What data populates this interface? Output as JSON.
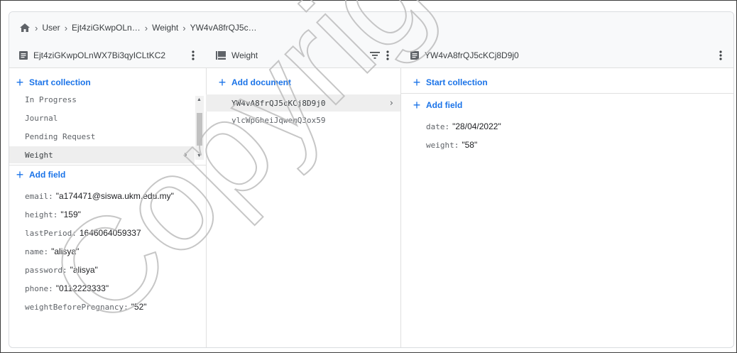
{
  "breadcrumb": {
    "items": [
      "User",
      "Ejt4ziGKwpOLn…",
      "Weight",
      "YW4vA8frQJ5c…"
    ]
  },
  "col1": {
    "title": "Ejt4ziGKwpOLnWX7Bi3qyICLtKC2",
    "start_collection": "Start collection",
    "collections": [
      "In Progress",
      "Journal",
      "Pending Request",
      "Weight"
    ],
    "add_field": "Add field",
    "fields": [
      {
        "key": "email:",
        "value": "\"a174471@siswa.ukm.edu.my\""
      },
      {
        "key": "height:",
        "value": "\"159\""
      },
      {
        "key": "lastPeriod:",
        "value": "1646064059337"
      },
      {
        "key": "name:",
        "value": "\"alisya\""
      },
      {
        "key": "password:",
        "value": "\"alisya\""
      },
      {
        "key": "phone:",
        "value": "\"0112223333\""
      },
      {
        "key": "weightBeforePregnancy:",
        "value": "\"52\""
      }
    ]
  },
  "col2": {
    "title": "Weight",
    "add_document": "Add document",
    "documents": [
      "YW4vA8frQJ5cKCj8D9j0",
      "ylcWpGheiJqwemQ3ox59"
    ]
  },
  "col3": {
    "title": "YW4vA8frQJ5cKCj8D9j0",
    "start_collection": "Start collection",
    "add_field": "Add field",
    "fields": [
      {
        "key": "date:",
        "value": "\"28/04/2022\""
      },
      {
        "key": "weight:",
        "value": "\"58\""
      }
    ]
  },
  "watermark": {
    "text": "Copyright@UKM"
  },
  "colors": {
    "accent": "#1a73e8",
    "selected": "#eeeeee",
    "border": "#e0e0e0"
  }
}
